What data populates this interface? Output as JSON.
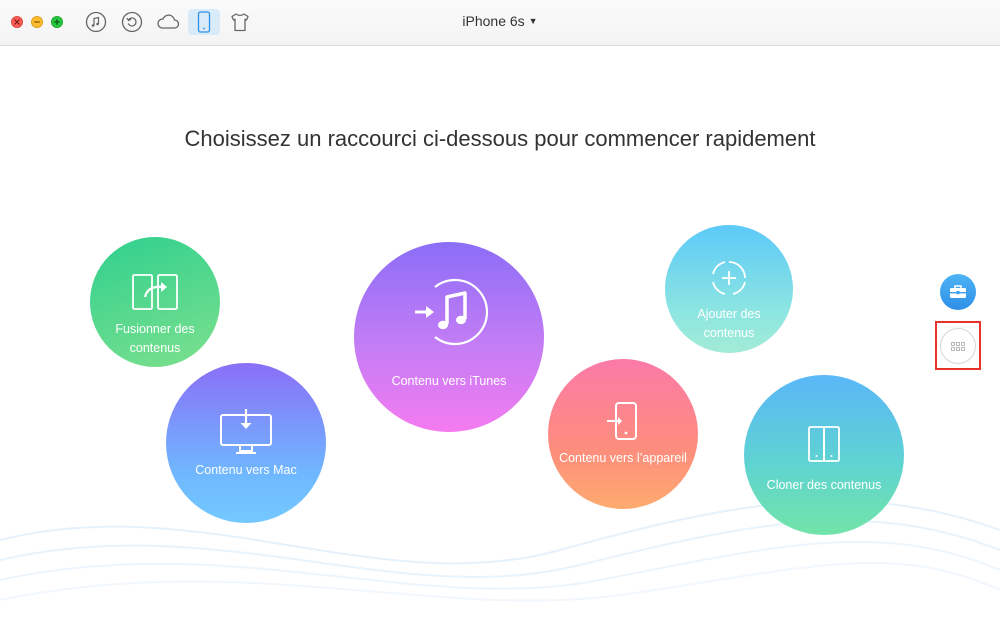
{
  "window": {
    "device_name": "iPhone 6s"
  },
  "toolbar": {
    "buttons": [
      {
        "name": "music",
        "icon": "music-note-icon",
        "active": false
      },
      {
        "name": "restore",
        "icon": "restore-arrow-icon",
        "active": false
      },
      {
        "name": "cloud",
        "icon": "cloud-icon",
        "active": false
      },
      {
        "name": "device",
        "icon": "phone-icon",
        "active": true
      },
      {
        "name": "shirt",
        "icon": "tshirt-icon",
        "active": false
      }
    ]
  },
  "main": {
    "headline": "Choisissez un raccourci ci-dessous pour commencer rapidement",
    "shortcuts": {
      "merge": {
        "label_line1": "Fusionner des",
        "label_line2": "contenus",
        "icon": "merge-tablets-icon"
      },
      "to_mac": {
        "label": "Contenu vers Mac",
        "icon": "monitor-download-icon"
      },
      "to_itunes": {
        "label": "Contenu vers iTunes",
        "icon": "itunes-note-icon"
      },
      "add": {
        "label_line1": "Ajouter des",
        "label_line2": "contenus",
        "icon": "add-circle-icon"
      },
      "to_device": {
        "label": "Contenu vers l’appareil",
        "icon": "phone-import-icon"
      },
      "clone": {
        "label": "Cloner des contenus",
        "icon": "clone-tablets-icon"
      }
    }
  },
  "side": {
    "toolbox_icon": "toolbox-icon",
    "grid_icon": "grid-dots-icon",
    "highlight_color": "#e8322b"
  },
  "colors": {
    "accent": "#2f8fe6",
    "active_tab_bg": "#d9ebf9"
  }
}
